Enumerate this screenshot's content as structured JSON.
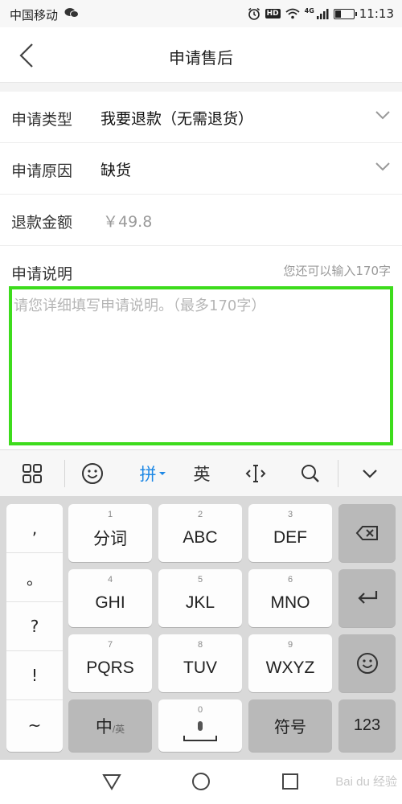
{
  "status_bar": {
    "carrier": "中国移动",
    "network": "4G",
    "hd": "HD",
    "time": "11:13"
  },
  "header": {
    "title": "申请售后"
  },
  "form": {
    "type_label": "申请类型",
    "type_value": "我要退款（无需退货）",
    "reason_label": "申请原因",
    "reason_value": "缺货",
    "amount_label": "退款金额",
    "amount_value": "￥49.8",
    "desc_label": "申请说明",
    "desc_hint": "您还可以输入170字",
    "desc_placeholder": "请您详细填写申请说明。（最多170字）"
  },
  "ime_toolbar": {
    "pinyin": "拼",
    "english": "英"
  },
  "keyboard": {
    "punct": [
      ",",
      "。",
      "?",
      "!",
      "~"
    ],
    "keys": [
      {
        "num": "1",
        "label": "分词"
      },
      {
        "num": "2",
        "label": "ABC"
      },
      {
        "num": "3",
        "label": "DEF"
      },
      {
        "num": "4",
        "label": "GHI"
      },
      {
        "num": "5",
        "label": "JKL"
      },
      {
        "num": "6",
        "label": "MNO"
      },
      {
        "num": "7",
        "label": "PQRS"
      },
      {
        "num": "8",
        "label": "TUV"
      },
      {
        "num": "9",
        "label": "WXYZ"
      }
    ],
    "zh_label": "中",
    "en_small": "/英",
    "space_num": "0",
    "symbol_label": "符号",
    "num_label": "123"
  },
  "watermark": "Bai du 经验",
  "colors": {
    "highlight_border": "#3ddc1c",
    "ime_accent": "#1e88e5"
  }
}
